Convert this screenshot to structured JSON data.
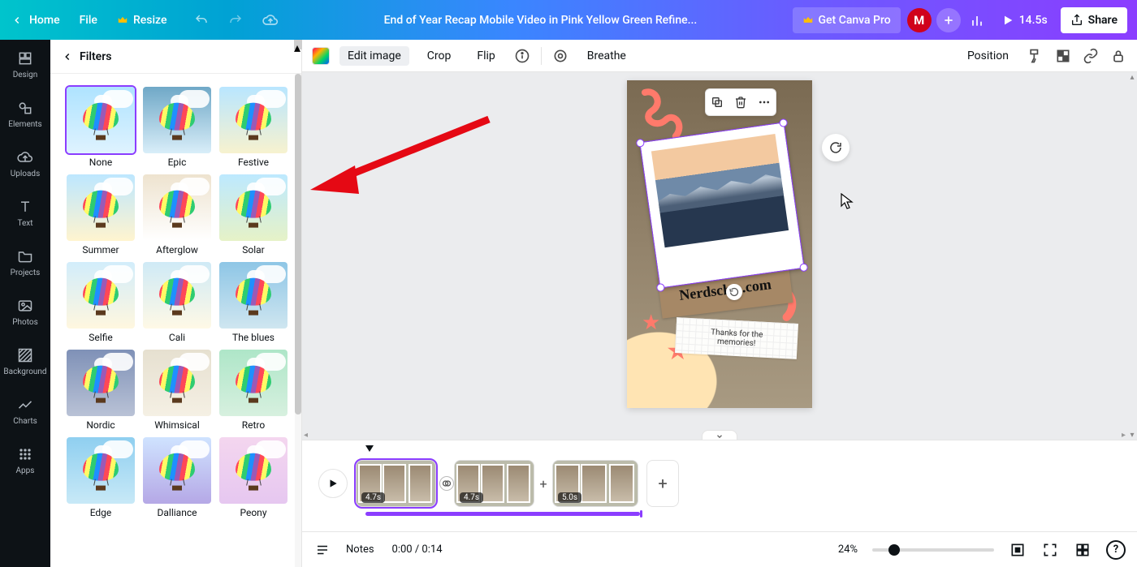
{
  "topbar": {
    "home": "Home",
    "file": "File",
    "resize": "Resize",
    "title": "End of Year Recap Mobile Video in Pink Yellow Green Refine...",
    "pro": "Get Canva Pro",
    "avatar_initial": "M",
    "duration": "14.5s",
    "share": "Share"
  },
  "rail": {
    "design": "Design",
    "elements": "Elements",
    "uploads": "Uploads",
    "text": "Text",
    "projects": "Projects",
    "photos": "Photos",
    "background": "Background",
    "charts": "Charts",
    "apps": "Apps"
  },
  "panel": {
    "title": "Filters",
    "filters": [
      "None",
      "Epic",
      "Festive",
      "Summer",
      "Afterglow",
      "Solar",
      "Selfie",
      "Cali",
      "The blues",
      "Nordic",
      "Whimsical",
      "Retro",
      "Edge",
      "Dalliance",
      "Peony"
    ],
    "selected": "None",
    "skies": {
      "None": "linear-gradient(180deg,#aee3ff,#dff3ff)",
      "Epic": "linear-gradient(180deg,#6fa8c7,#d9eef9)",
      "Festive": "linear-gradient(180deg,#b9e6ff,#f7f2cf)",
      "Summer": "linear-gradient(180deg,#bde7ff,#fff4cf)",
      "Afterglow": "linear-gradient(180deg,#eee3cf,#fff)",
      "Solar": "linear-gradient(180deg,#bde9ff,#e6f2c7)",
      "Selfie": "linear-gradient(180deg,#d2edfb,#fff7df)",
      "Cali": "linear-gradient(180deg,#cfeaf6,#fff9e6)",
      "The blues": "linear-gradient(180deg,#8ec6e6,#cfe6f0)",
      "Nordic": "linear-gradient(180deg,#7f91b7,#b9c2d6)",
      "Whimsical": "linear-gradient(180deg,#e6e0d0,#f5f0e4)",
      "Retro": "linear-gradient(180deg,#aee6c8,#d7f0df)",
      "Edge": "linear-gradient(180deg,#8fcff0,#c8e9f7)",
      "Dalliance": "linear-gradient(180deg,#cfe3ff,#b5a8e6)",
      "Peony": "linear-gradient(180deg,#f4d6ef,#e6c7f0)"
    }
  },
  "ctx": {
    "edit_image": "Edit image",
    "crop": "Crop",
    "flip": "Flip",
    "breathe": "Breathe",
    "position": "Position"
  },
  "design": {
    "brand": "Nerdscha   .com",
    "memo": "Thanks for the\nmemories!"
  },
  "timeline": {
    "clips": [
      {
        "duration": "4.7s",
        "selected": true
      },
      {
        "duration": "4.7s",
        "selected": false
      },
      {
        "duration": "5.0s",
        "selected": false
      }
    ]
  },
  "status": {
    "notes": "Notes",
    "time": "0:00 / 0:14",
    "zoom": "24%",
    "zoom_pct": 18
  }
}
